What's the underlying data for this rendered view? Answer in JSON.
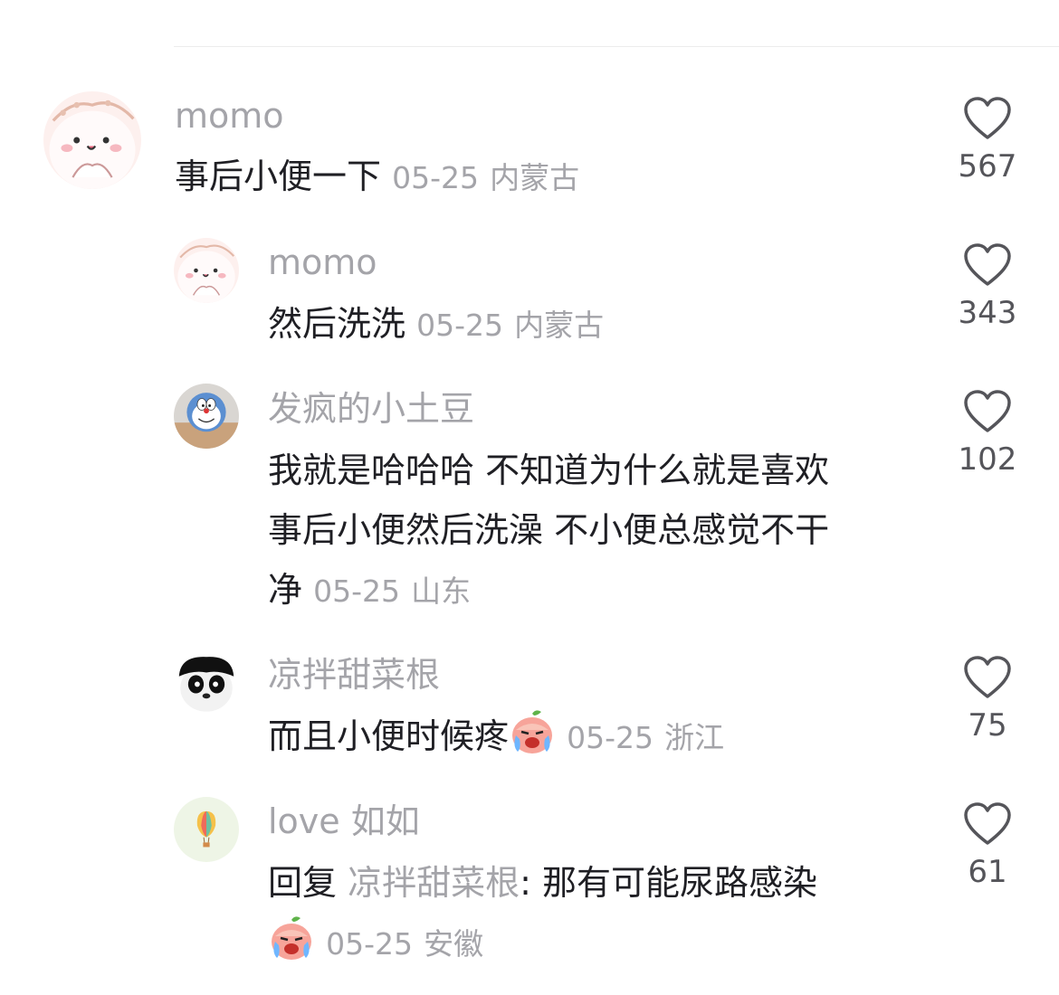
{
  "comments": [
    {
      "username": "momo",
      "text": "事后小便一下",
      "date": "05-25",
      "location": "内蒙古",
      "likes": "567",
      "avatar_icon": "cute-cat-avatar"
    },
    {
      "username": "momo",
      "text": "然后洗洗",
      "date": "05-25",
      "location": "内蒙古",
      "likes": "343",
      "avatar_icon": "cute-cat-avatar"
    },
    {
      "username": "发疯的小土豆",
      "text_lines": [
        "我就是哈哈哈 不知道为什么就是喜欢",
        "事后小便然后洗澡 不小便总感觉不干",
        "净"
      ],
      "date": "05-25",
      "location": "山东",
      "likes": "102",
      "avatar_icon": "doraemon-avatar"
    },
    {
      "username": "凉拌甜菜根",
      "text": "而且小便时候疼",
      "emoji": "crying-peach-emoji",
      "date": "05-25",
      "location": "浙江",
      "likes": "75",
      "avatar_icon": "panda-avatar"
    },
    {
      "username": "love 如如",
      "reply_prefix": "回复",
      "reply_to": "凉拌甜菜根",
      "reply_sep": ":",
      "text": "那有可能尿路感染",
      "emoji": "crying-peach-emoji",
      "date": "05-25",
      "location": "安徽",
      "likes": "61",
      "avatar_icon": "hot-air-balloon-avatar"
    }
  ],
  "colors": {
    "username": "#a4a4a9",
    "body": "#1f1f24",
    "meta": "#a4a4a9",
    "like_icon": "#55555a"
  }
}
